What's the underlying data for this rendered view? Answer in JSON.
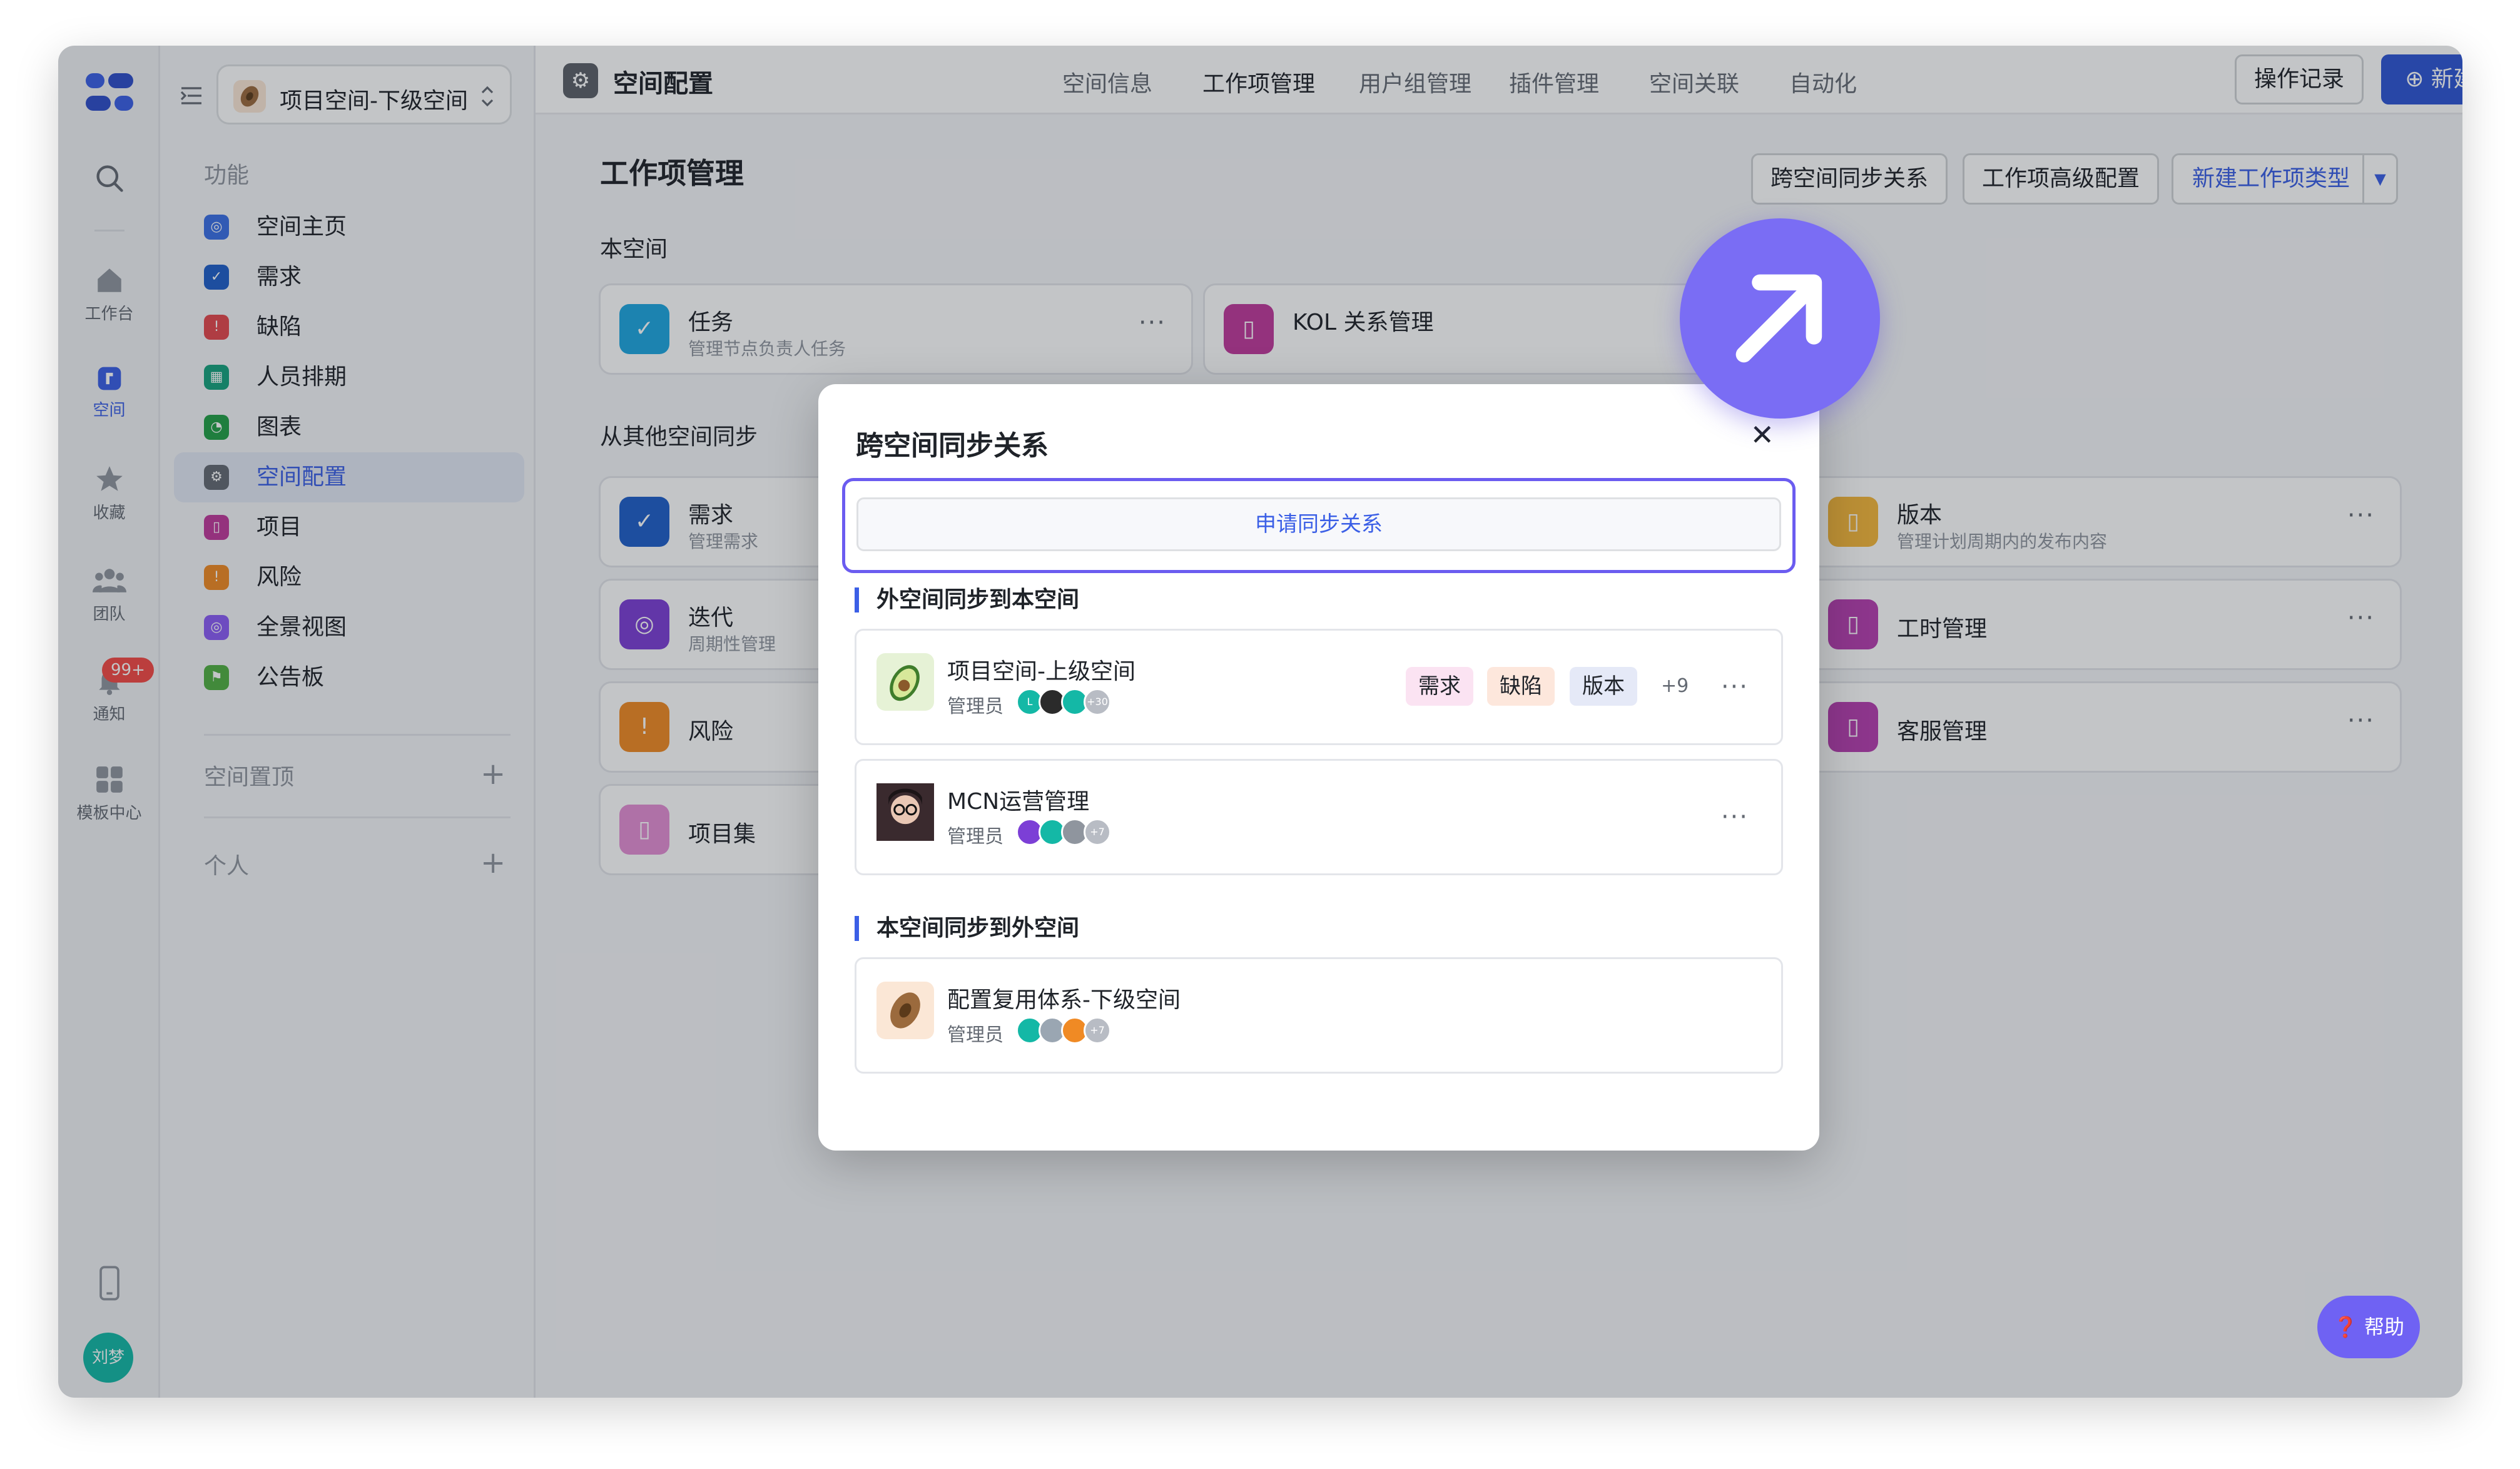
{
  "rail": {
    "items": [
      {
        "key": "search",
        "label": ""
      },
      {
        "key": "workbench",
        "label": "工作台"
      },
      {
        "key": "space",
        "label": "空间"
      },
      {
        "key": "favorites",
        "label": "收藏"
      },
      {
        "key": "team",
        "label": "团队"
      },
      {
        "key": "notify",
        "label": "通知"
      },
      {
        "key": "templates",
        "label": "模板中心"
      }
    ],
    "notify_badge": "99+",
    "user_initials": "刘梦"
  },
  "sidebar": {
    "space_name": "项目空间-下级空间",
    "section_function": "功能",
    "items": [
      {
        "label": "空间主页",
        "color": "#3b6fe6"
      },
      {
        "label": "需求",
        "color": "#1f5fc9"
      },
      {
        "label": "缺陷",
        "color": "#e5484d"
      },
      {
        "label": "人员排期",
        "color": "#16a37e"
      },
      {
        "label": "图表",
        "color": "#23a047"
      },
      {
        "label": "空间配置",
        "color": "#646a73"
      },
      {
        "label": "项目",
        "color": "#c0399b"
      },
      {
        "label": "风险",
        "color": "#f08a24"
      },
      {
        "label": "全景视图",
        "color": "#8b5cf6"
      },
      {
        "label": "公告板",
        "color": "#52b043"
      }
    ],
    "section_pinned": "空间置顶",
    "section_personal": "个人"
  },
  "topbar": {
    "title": "空间配置",
    "tabs": [
      "空间信息",
      "工作项管理",
      "用户组管理",
      "插件管理",
      "空间关联",
      "自动化"
    ],
    "active_tab": "工作项管理",
    "op_log": "操作记录",
    "new_btn": "新建"
  },
  "main": {
    "title": "工作项管理",
    "btn_sync": "跨空间同步关系",
    "btn_advanced": "工作项高级配置",
    "btn_new_type": "新建工作项类型",
    "section_this": "本空间",
    "section_other": "从其他空间同步",
    "cards": {
      "task": {
        "title": "任务",
        "sub": "管理节点负责人任务"
      },
      "kol": {
        "title": "KOL 关系管理",
        "sub": ""
      },
      "story": {
        "title": "需求",
        "sub": "管理需求"
      },
      "iteration": {
        "title": "迭代",
        "sub": "周期性管理"
      },
      "risk": {
        "title": "风险",
        "sub": ""
      },
      "projectset": {
        "title": "项目集",
        "sub": ""
      },
      "version": {
        "title": "版本",
        "sub": "管理计划周期内的发布内容"
      },
      "timesheet": {
        "title": "工时管理",
        "sub": ""
      },
      "service": {
        "title": "客服管理",
        "sub": ""
      }
    },
    "more": "···"
  },
  "modal": {
    "title": "跨空间同步关系",
    "close": "✕",
    "apply_btn": "申请同步关系",
    "section_in": "外空间同步到本空间",
    "section_out": "本空间同步到外空间",
    "admin_label": "管理员",
    "spaces_in": [
      {
        "name": "项目空间-上级空间",
        "tags": [
          "需求",
          "缺陷",
          "版本"
        ],
        "more_tags": "+9",
        "avatar_more": "+30"
      },
      {
        "name": "MCN运营管理",
        "tags": [],
        "more_tags": "",
        "avatar_more": "+7"
      }
    ],
    "spaces_out": [
      {
        "name": "配置复用体系-下级空间",
        "avatar_more": "+7"
      }
    ]
  },
  "help": "帮助",
  "colors": {
    "accent": "#3b5fe6",
    "fab": "#7a6df4"
  }
}
